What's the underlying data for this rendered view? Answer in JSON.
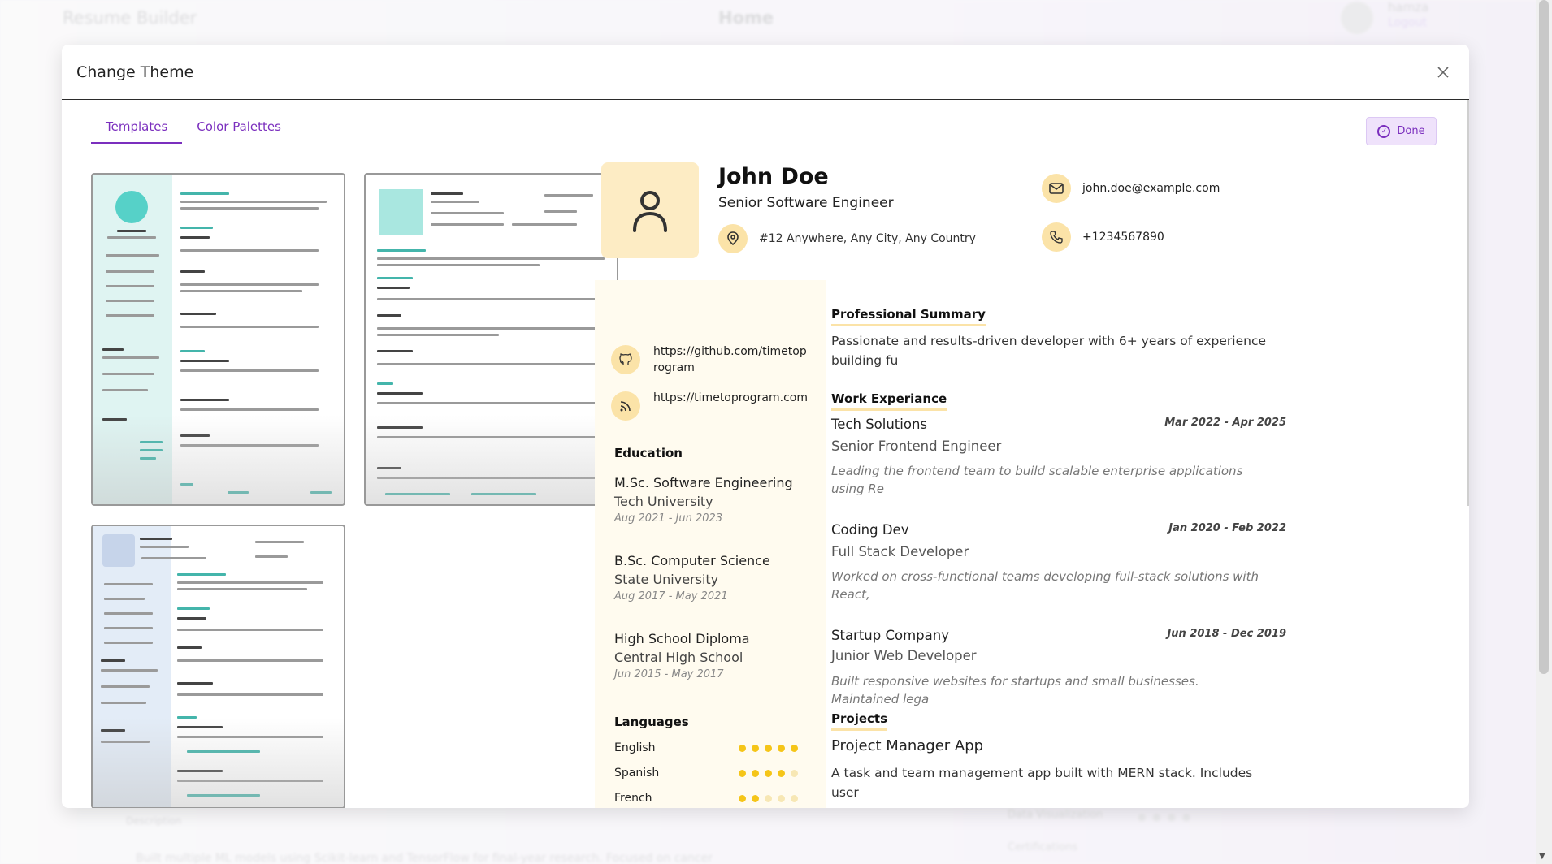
{
  "background": {
    "brand": "Resume Builder",
    "nav_home": "Home",
    "user_name": "hamza",
    "logout": "Logout",
    "description_label": "Description",
    "description_text": "Built multiple ML models using Scikit-learn and TensorFlow for final-year research. Focused on cancer",
    "data_visualization": "Data Visualization",
    "certifications": "Certifications"
  },
  "modal": {
    "title": "Change Theme",
    "close_icon": "close-icon",
    "tabs": [
      {
        "label": "Templates",
        "active": true
      },
      {
        "label": "Color Palettes",
        "active": false
      }
    ],
    "done_label": "Done"
  },
  "preview": {
    "name": "John Doe",
    "job_title": "Senior Software Engineer",
    "address": "#12 Anywhere, Any City, Any Country",
    "email": "john.doe@example.com",
    "phone": "+1234567890",
    "github": "https://github.com/timetop rogram",
    "website": "https://timetoprogram.com",
    "education_title": "Education",
    "education": [
      {
        "degree": "M.Sc. Software Engineering",
        "school": "Tech University",
        "dates": "Aug 2021 - Jun 2023"
      },
      {
        "degree": "B.Sc. Computer Science",
        "school": "State University",
        "dates": "Aug 2017 - May 2021"
      },
      {
        "degree": "High School Diploma",
        "school": "Central High School",
        "dates": "Jun 2015 - May 2017"
      }
    ],
    "languages_title": "Languages",
    "languages": [
      {
        "name": "English",
        "level": 5
      },
      {
        "name": "Spanish",
        "level": 4
      },
      {
        "name": "French",
        "level": 2
      }
    ],
    "summary_title": "Professional Summary",
    "summary": "Passionate and results-driven developer with 6+ years of experience building fu",
    "work_title": "Work Experiance",
    "work": [
      {
        "company": "Tech Solutions",
        "dates": "Mar 2022 - Apr 2025",
        "role": "Senior Frontend Engineer",
        "desc": "Leading the frontend team to build scalable enterprise applications using Re"
      },
      {
        "company": "Coding Dev",
        "dates": "Jan 2020 - Feb 2022",
        "role": "Full Stack Developer",
        "desc": "Worked on cross-functional teams developing full-stack solutions with React,"
      },
      {
        "company": "Startup Company",
        "dates": "Jun 2018 - Dec 2019",
        "role": "Junior Web Developer",
        "desc": "Built responsive websites for startups and small businesses. Maintained lega"
      }
    ],
    "projects_title": "Projects",
    "project": {
      "name": "Project Manager App",
      "desc": "A task and team management app built with MERN stack. Includes user"
    }
  },
  "colors": {
    "accent": "#7b2fbe",
    "preview_accent": "#fbe3a8",
    "rating": "#f5c518"
  }
}
